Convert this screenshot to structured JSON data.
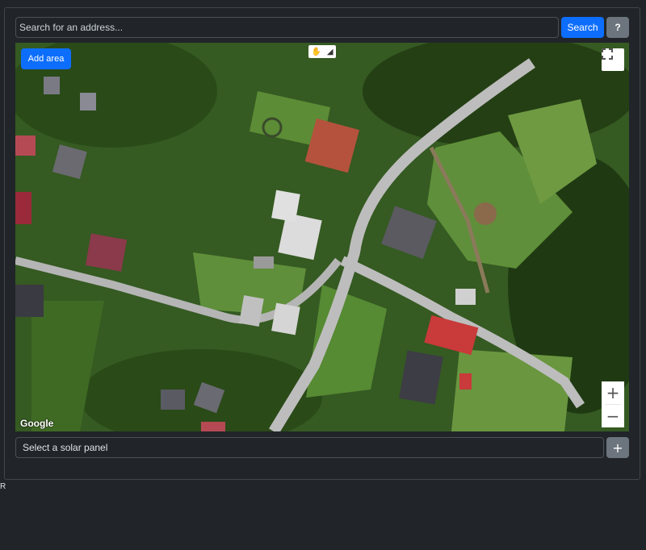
{
  "search": {
    "placeholder": "Search for an address...",
    "button_label": "Search",
    "help_label": "?"
  },
  "map": {
    "add_area_label": "Add area",
    "zoom_in": "+",
    "zoom_out": "−",
    "attribution": "Google",
    "tool_hand": "✋",
    "tool_draw": "◢"
  },
  "panel_select": {
    "selected": "Select a solar panel",
    "add_label": "+"
  },
  "footer": {
    "stray_text": "R"
  },
  "colors": {
    "primary": "#0d6efd",
    "secondary": "#6c757d",
    "background": "#212529"
  }
}
